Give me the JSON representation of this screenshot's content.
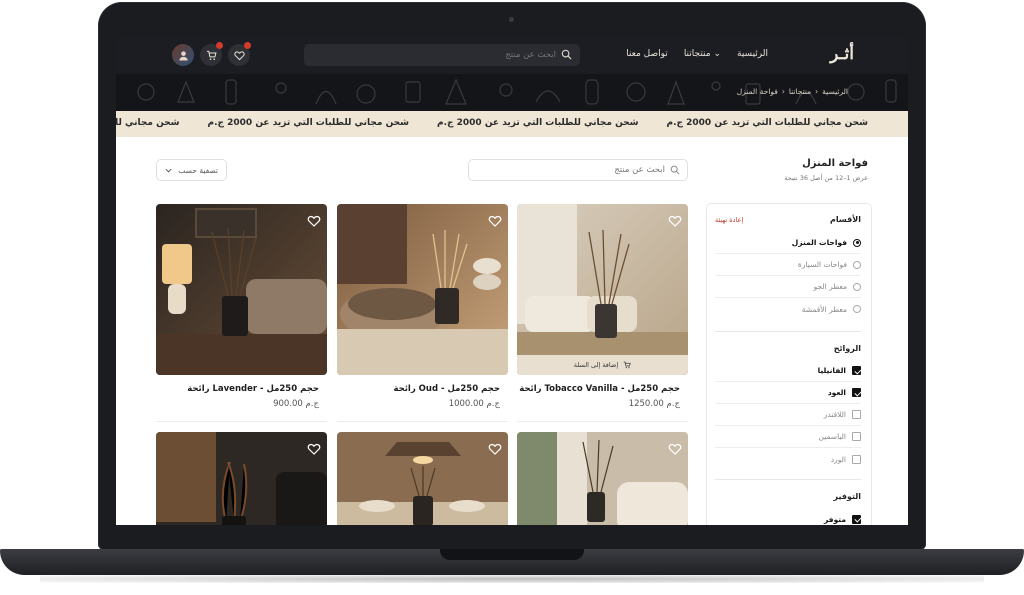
{
  "header": {
    "logo": "أثـر",
    "nav": [
      "الرئيسية",
      "منتجاتنا ⌄",
      "تواصل معنا"
    ],
    "search_placeholder": "ابحث عن منتج"
  },
  "breadcrumb": [
    "الرئيسية",
    "منتجاتنا",
    "فواحة المنزل"
  ],
  "ticker": [
    "شحن مجاني للطلبات التي تزيد عن 2000 ج.م",
    "شحن مجاني للطلبات التي تزيد عن 2000 ج.م",
    "شحن مجاني للطلبات التي تزيد عن 2000 ج.م",
    "شحن مجاني للطلبات التي تزيد عن 2000 ج.م"
  ],
  "page": {
    "title": "فواحة المنزل",
    "result_count": "عرض 1–12 من أصل 36 نتيجة",
    "search_placeholder": "ابحث عن منتج",
    "sort_label": "تصفية حسب"
  },
  "filters": {
    "categories_title": "الأقسام",
    "reset_label": "إعادة تهيئة",
    "categories": [
      {
        "label": "فواحات المنزل",
        "selected": true
      },
      {
        "label": "فواحات السيارة",
        "selected": false
      },
      {
        "label": "معطر الجو",
        "selected": false
      },
      {
        "label": "معطر الأقمشة",
        "selected": false
      }
    ],
    "scents_title": "الروائح",
    "scents": [
      {
        "label": "الفانيليا",
        "checked": true
      },
      {
        "label": "العود",
        "checked": true
      },
      {
        "label": "اللافندر",
        "checked": false
      },
      {
        "label": "الياسمين",
        "checked": false
      },
      {
        "label": "الورد",
        "checked": false
      }
    ],
    "availability_title": "التوفير",
    "availability": [
      {
        "label": "متوفر",
        "checked": true
      }
    ]
  },
  "products": [
    {
      "name": "رائحة Tobacco Vanilla  -  حجم 250مل",
      "price": "1250.00 ج.م",
      "add_to_cart": "إضافة إلى السلة"
    },
    {
      "name": "رائحة Oud  -  حجم 250مل",
      "price": "1000.00 ج.م"
    },
    {
      "name": "رائحة Lavender  -  حجم 250مل",
      "price": "900.00 ج.م"
    }
  ],
  "colors": {
    "accent": "#c0392b",
    "dark": "#1c1d22",
    "cream": "#efe6d6"
  }
}
